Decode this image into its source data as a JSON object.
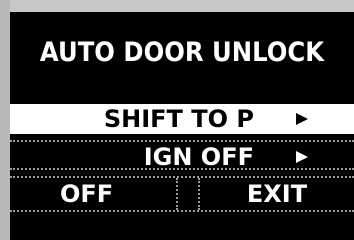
{
  "screen": {
    "title": "AUTO DOOR UNLOCK"
  },
  "menu": {
    "items": [
      {
        "label": "SHIFT TO P",
        "icon": "right-triangle-icon",
        "selected": true
      },
      {
        "label": "IGN OFF",
        "icon": "right-triangle-icon",
        "selected": false
      }
    ]
  },
  "softkeys": {
    "off_label": "OFF",
    "exit_label": "EXIT"
  },
  "colors": {
    "background": "#000000",
    "text": "#ffffff",
    "highlight": "#ffffff",
    "divider": "#9a9a9a"
  }
}
